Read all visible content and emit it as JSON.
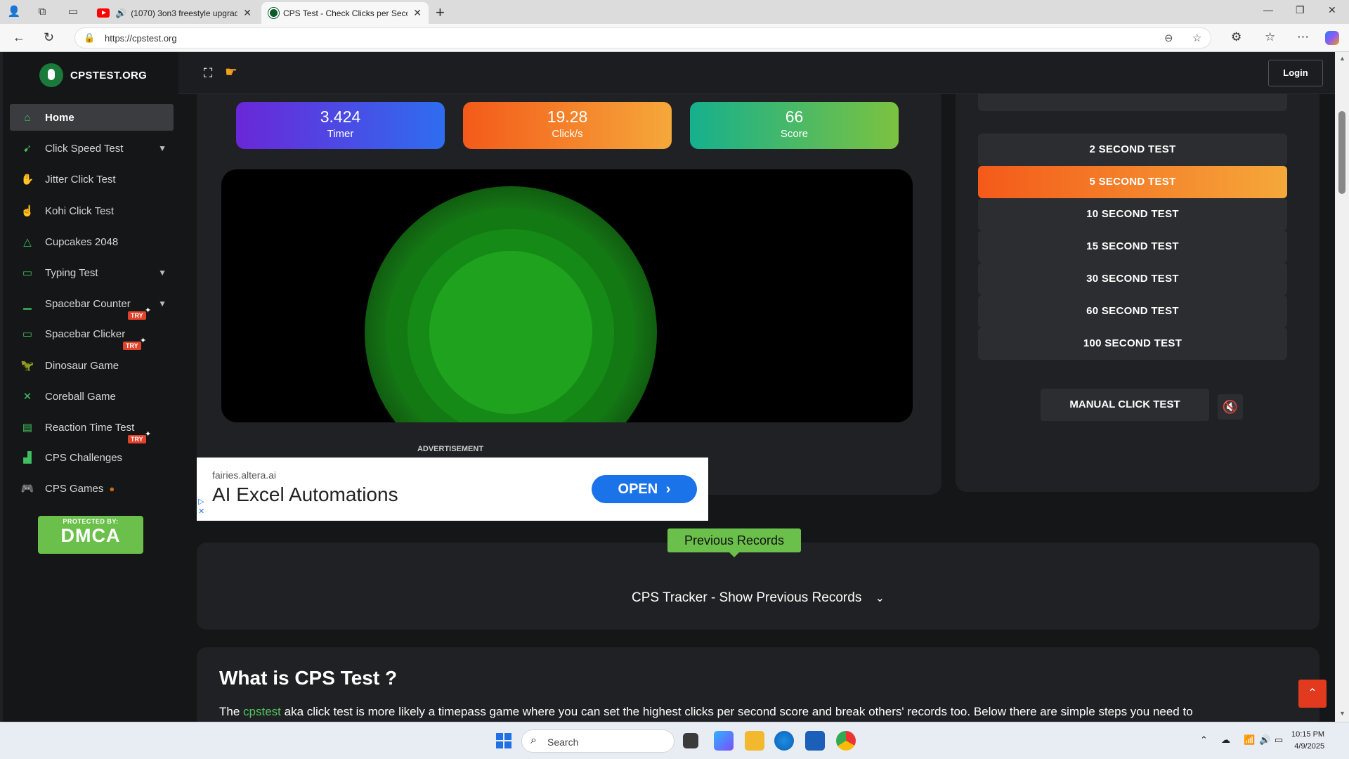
{
  "browser": {
    "tabs": [
      {
        "title": "(1070) 3on3 freestyle upgrad",
        "icon": "youtube-icon",
        "active": false
      },
      {
        "title": "CPS Test - Check Clicks per Secon",
        "icon": "cpstest-icon",
        "active": true
      }
    ],
    "url": "https://cpstest.org"
  },
  "site": {
    "logo_text": "CPSTEST.ORG",
    "login_label": "Login"
  },
  "sidebar": {
    "items": [
      {
        "label": "Home",
        "icon": "home-icon",
        "active": true
      },
      {
        "label": "Click Speed Test",
        "icon": "cursor-icon",
        "chevron": true
      },
      {
        "label": "Jitter Click Test",
        "icon": "jitter-icon"
      },
      {
        "label": "Kohi Click Test",
        "icon": "pointer-icon"
      },
      {
        "label": "Cupcakes 2048",
        "icon": "cupcake-icon"
      },
      {
        "label": "Typing Test",
        "icon": "keyboard-icon",
        "chevron": true
      },
      {
        "label": "Spacebar Counter",
        "icon": "spacebar-icon",
        "chevron": true,
        "badge": "TRY"
      },
      {
        "label": "Spacebar Clicker",
        "icon": "spacebar-icon",
        "badge": "TRY"
      },
      {
        "label": "Dinosaur Game",
        "icon": "dino-icon"
      },
      {
        "label": "Coreball Game",
        "icon": "coreball-icon"
      },
      {
        "label": "Reaction Time Test",
        "icon": "reaction-icon",
        "badge": "TRY"
      },
      {
        "label": "CPS Challenges",
        "icon": "chart-icon"
      },
      {
        "label": "CPS Games",
        "icon": "gamepad-icon"
      }
    ],
    "dmca": {
      "protected": "PROTECTED BY:",
      "brand": "DMCA"
    }
  },
  "stats": {
    "timer": {
      "value": "3.424",
      "label": "Timer"
    },
    "cps": {
      "value": "19.28",
      "label": "Click/s"
    },
    "score": {
      "value": "66",
      "label": "Score"
    }
  },
  "tests": {
    "buttons": [
      "2 SECOND TEST",
      "5 SECOND TEST",
      "10 SECOND TEST",
      "15 SECOND TEST",
      "30 SECOND TEST",
      "60 SECOND TEST",
      "100 SECOND TEST"
    ],
    "active": "5 SECOND TEST",
    "manual": "MANUAL CLICK TEST"
  },
  "ad": {
    "label": "ADVERTISEMENT",
    "domain": "fairies.altera.ai",
    "headline": "AI Excel Automations",
    "cta": "OPEN"
  },
  "records": {
    "tag": "Previous Records",
    "toggle": "CPS Tracker - Show Previous Records"
  },
  "info": {
    "heading": "What is CPS Test ?",
    "para_prefix": "The ",
    "para_link": "cpstest",
    "para_rest": " aka click test is more likely a timepass game where you can set the highest clicks per second score and break others' records too. Below there are simple steps you need to"
  },
  "taskbar": {
    "search_placeholder": "Search",
    "time": "10:15 PM",
    "date": "4/9/2025"
  },
  "colors": {
    "accent_green": "#6bc04b",
    "orange": "#f45a1a",
    "page_bg": "#151618"
  }
}
